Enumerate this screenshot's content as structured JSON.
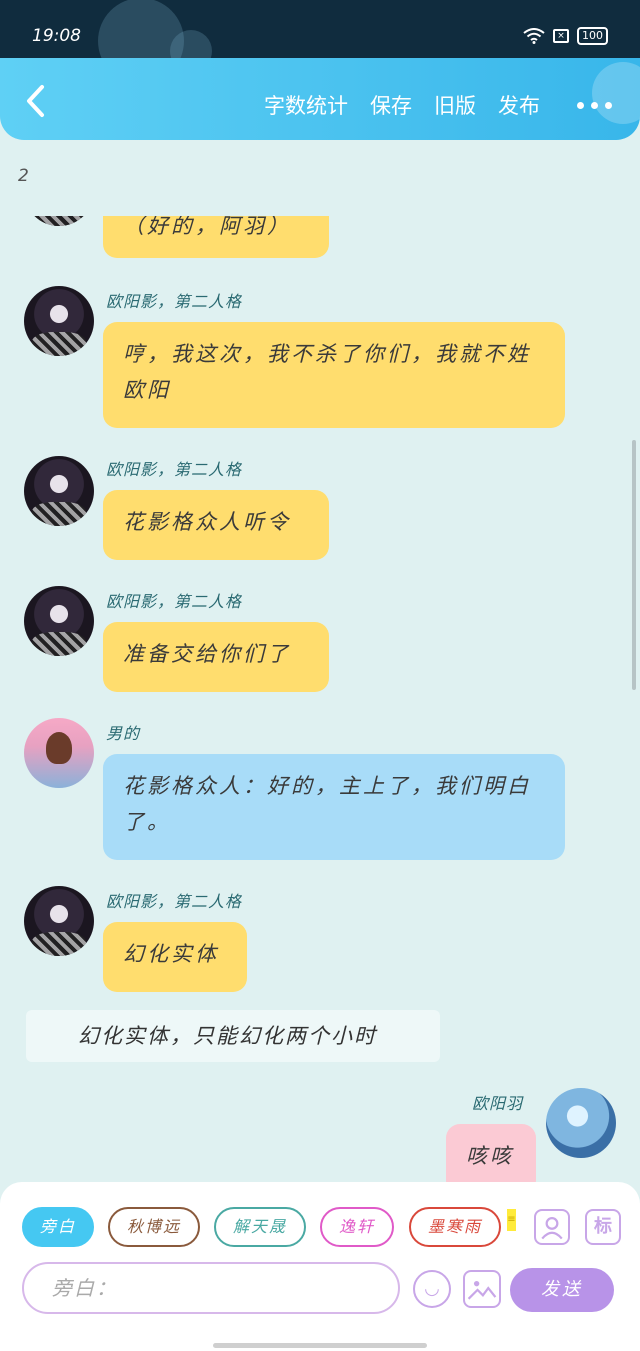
{
  "status": {
    "time": "19:08",
    "battery": "100"
  },
  "topbar": {
    "actions": [
      "字数统计",
      "保存",
      "旧版",
      "发布"
    ]
  },
  "scroll_index": "2",
  "messages": [
    {
      "text": "（好的，阿羽）"
    },
    {
      "name": "欧阳影，第二人格",
      "text": "哼，我这次，我不杀了你们，我就不姓欧阳"
    },
    {
      "name": "欧阳影，第二人格",
      "text": "花影格众人听令"
    },
    {
      "name": "欧阳影，第二人格",
      "text": "准备交给你们了"
    },
    {
      "name": "男的",
      "text": "花影格众人：好的，主上了，我们明白了。"
    },
    {
      "name": "欧阳影，第二人格",
      "text": "幻化实体"
    },
    {
      "narration": "幻化实体，只能幻化两个小时"
    },
    {
      "name": "欧阳羽",
      "text": "咳咳"
    }
  ],
  "composer": {
    "chips": [
      {
        "label": "旁白",
        "color": "#45c8f2"
      },
      {
        "label": "秋博远",
        "color": "#8a5a3c"
      },
      {
        "label": "解天晟",
        "color": "#4aa9a3"
      },
      {
        "label": "逸轩",
        "color": "#e05ac8"
      },
      {
        "label": "墨寒雨",
        "color": "#d9483b"
      }
    ],
    "tag_icon": "标",
    "placeholder": "旁白：",
    "send_label": "发送"
  }
}
